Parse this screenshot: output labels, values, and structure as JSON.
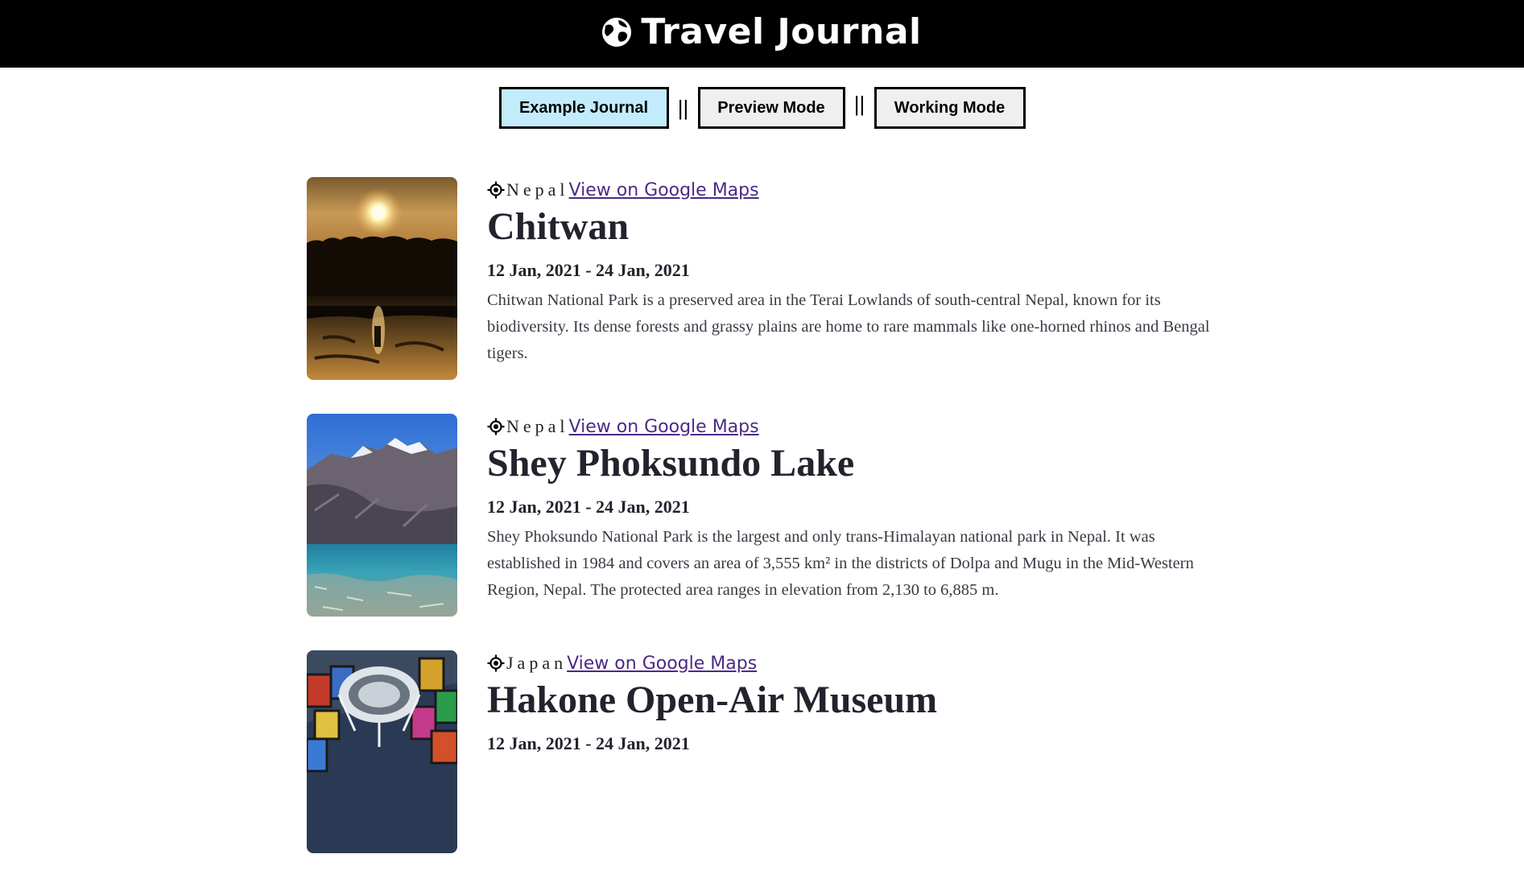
{
  "header": {
    "title": "Travel Journal",
    "icon": "globe-icon"
  },
  "modes": {
    "example_label": "Example Journal",
    "preview_label": "Preview Mode",
    "working_label": "Working Mode",
    "separator": "||",
    "active": "example",
    "active_color": "#c2ecfb"
  },
  "entries": [
    {
      "country": "Nepal",
      "map_link": "View on Google Maps",
      "title": "Chitwan",
      "dates": "12 Jan, 2021 - 24 Jan, 2021",
      "description": "Chitwan National Park is a preserved area in the Terai Lowlands of south-central Nepal, known for its biodiversity. Its dense forests and grassy plains are home to rare mammals like one-horned rhinos and Bengal tigers."
    },
    {
      "country": "Nepal",
      "map_link": "View on Google Maps",
      "title": "Shey Phoksundo Lake",
      "dates": "12 Jan, 2021 - 24 Jan, 2021",
      "description": "Shey Phoksundo National Park is the largest and only trans-Himalayan national park in Nepal. It was established in 1984 and covers an area of 3,555 km² in the districts of Dolpa and Mugu in the Mid-Western Region, Nepal. The protected area ranges in elevation from 2,130 to 6,885 m."
    },
    {
      "country": "Japan",
      "map_link": "View on Google Maps",
      "title": "Hakone Open-Air Museum",
      "dates": "12 Jan, 2021 - 24 Jan, 2021",
      "description": ""
    }
  ],
  "colors": {
    "header_bg": "#000000",
    "link": "#4b2a86",
    "title_text": "#23232e"
  }
}
